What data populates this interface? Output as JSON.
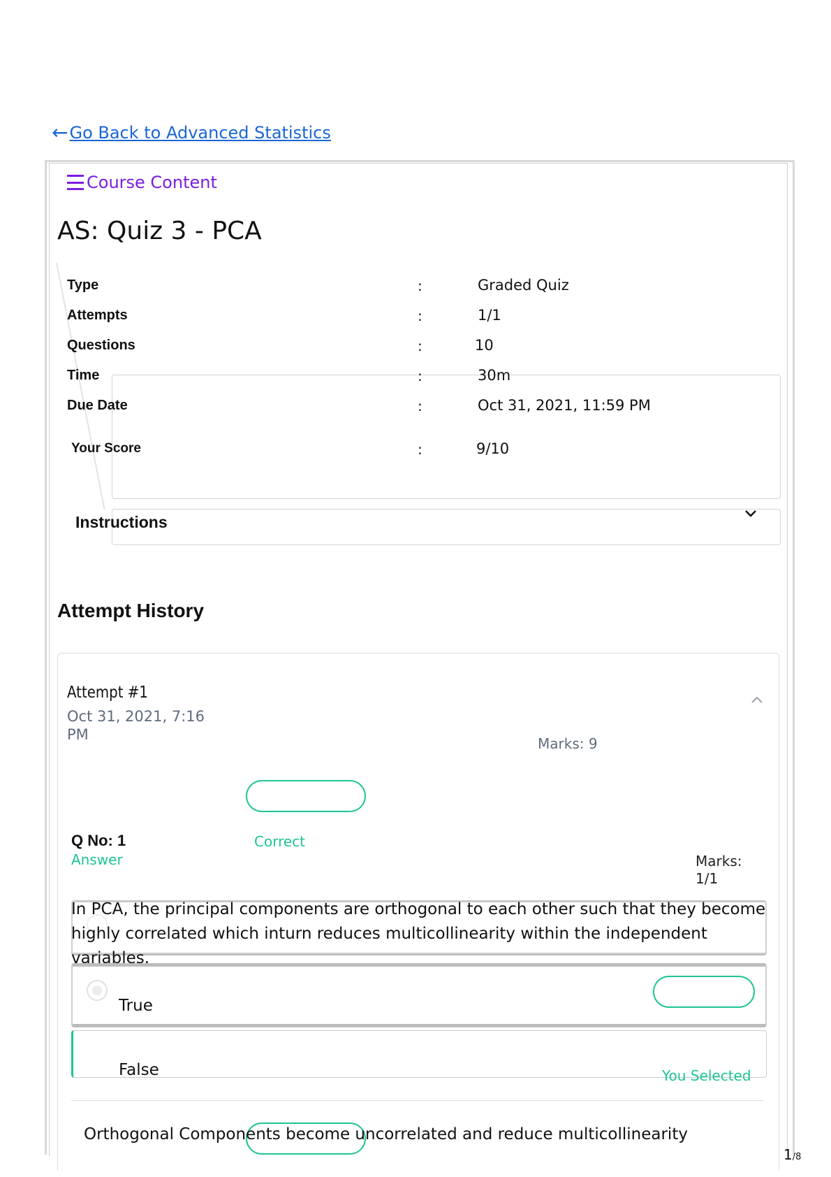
{
  "nav": {
    "back_icon": "arrow-left-icon",
    "back_label": "Go Back to Advanced Statistics"
  },
  "sidebar_toggle": {
    "icon": "hamburger-menu-icon",
    "label": "Course Content"
  },
  "quiz": {
    "title": "AS: Quiz 3 - PCA",
    "info": [
      {
        "label": "Type",
        "value": "Graded Quiz"
      },
      {
        "label": "Attempts",
        "value": "1/1"
      },
      {
        "label": "Questions",
        "value": "10"
      },
      {
        "label": "Time",
        "value": "30m"
      },
      {
        "label": "Due Date",
        "value": "Oct 31, 2021, 11:59 PM"
      },
      {
        "label": "Your Score",
        "value": "9/10"
      }
    ],
    "separator": ":",
    "instructions_label": "Instructions"
  },
  "history": {
    "heading": "Attempt History",
    "attempt": {
      "number": "Attempt #1",
      "date": "Oct 31, 2021, 7:16 PM",
      "marks": "Marks: 9"
    },
    "question": {
      "qno": "Q No: 1",
      "answer_label": "Answer",
      "status": "Correct",
      "marks": "Marks: 1/1",
      "text": "In PCA, the principal components are orthogonal to each other such that they become highly correlated which inturn reduces multicollinearity within the independent variables.",
      "options": [
        {
          "label": "True"
        },
        {
          "label": "False",
          "note": "You Selected"
        }
      ],
      "explanation": "Orthogonal Components become uncorrelated and reduce multicollinearity"
    }
  },
  "footer": {
    "page": "1",
    "total": "/8"
  },
  "colors": {
    "link": "#1a66d6",
    "accent_purple": "#7a1fe0",
    "success": "#1ec494",
    "muted": "#5f6b7c"
  }
}
